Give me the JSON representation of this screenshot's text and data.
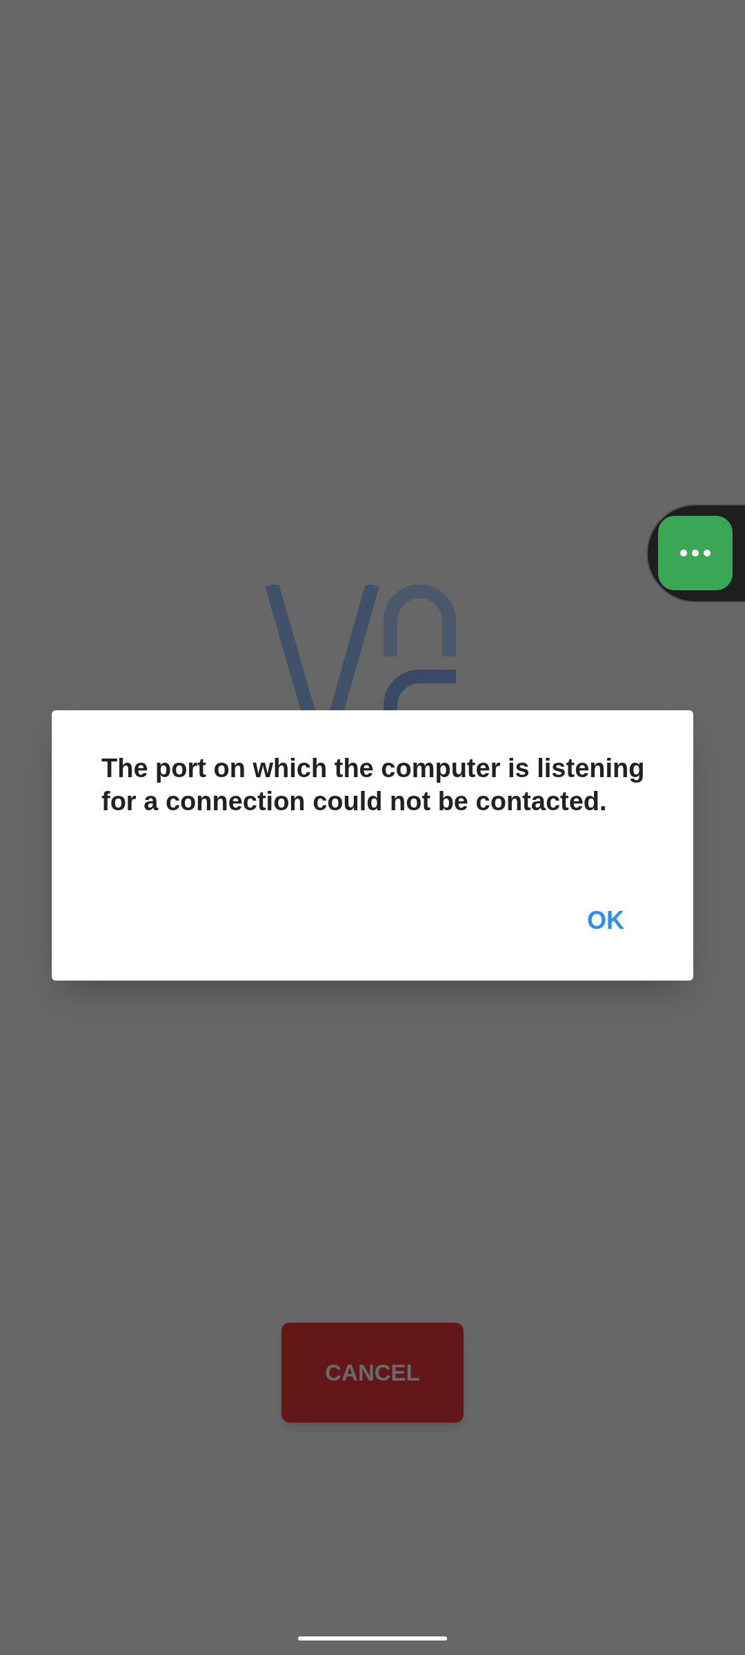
{
  "dialog": {
    "message": "The port on which the computer is listening for a connection could not be contacted.",
    "buttons": [
      "OK"
    ]
  },
  "cancel_button": "CANCEL"
}
